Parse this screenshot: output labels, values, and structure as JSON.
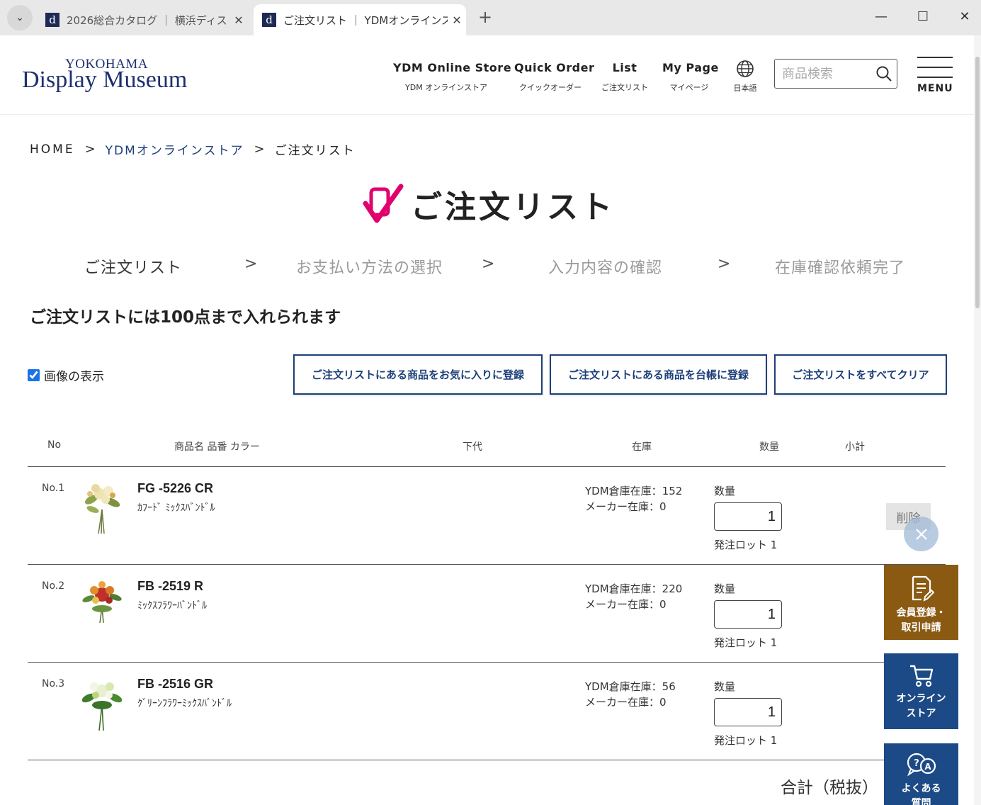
{
  "browser": {
    "tabs": [
      {
        "title": "2026総合カタログ ｜ 横浜ディス",
        "favicon_letter": "d",
        "active": false
      },
      {
        "title": "ご注文リスト ｜ YDMオンラインスト",
        "favicon_letter": "d",
        "active": true
      }
    ],
    "new_tab": "+",
    "controls": {
      "minimize": "—",
      "maximize": "☐",
      "close": "✕"
    },
    "tab_close": "✕",
    "tab_menu": "⌄"
  },
  "header": {
    "logo_top": "YOKOHAMA",
    "logo_main": "Display Museum",
    "nav": [
      {
        "en": "YDM Online Store",
        "ja": "YDM オンラインストア"
      },
      {
        "en": "Quick Order",
        "ja": "クイックオーダー"
      },
      {
        "en": "List",
        "ja": "ご注文リスト"
      },
      {
        "en": "My Page",
        "ja": "マイページ"
      }
    ],
    "language": "日本語",
    "search_placeholder": "商品検索",
    "menu_label": "MENU"
  },
  "breadcrumb": {
    "home": "HOME",
    "store": "YDMオンラインストア",
    "current": "ご注文リスト",
    "separator": ">"
  },
  "page_title": "ご注文リスト",
  "steps": [
    {
      "label": "ご注文リスト",
      "active": true
    },
    {
      "label": "お支払い方法の選択",
      "active": false
    },
    {
      "label": "入力内容の確認",
      "active": false
    },
    {
      "label": "在庫確認依頼完了",
      "active": false
    }
  ],
  "step_arrow": ">",
  "limit_text": "ご注文リストには100点まで入れられます",
  "show_images": {
    "label": "画像の表示",
    "checked": true
  },
  "actions": {
    "add_favorites": "ご注文リストにある商品をお気に入りに登録",
    "add_ledger": "ご注文リストにある商品を台帳に登録",
    "clear_all": "ご注文リストをすべてクリア"
  },
  "table": {
    "headers": {
      "no": "No",
      "name": "商品名 品番 カラー",
      "price": "下代",
      "stock": "在庫",
      "qty": "数量",
      "subtotal": "小計"
    },
    "rows": [
      {
        "no": "No.1",
        "code": "FG -5226 CR",
        "name": "ｶﾌｰﾄﾞ ﾐｯｸｽﾊﾞﾝﾄﾞﾙ",
        "stock_ydm": "YDM倉庫在庫：152",
        "stock_maker": "メーカー在庫：0",
        "qty_label": "数量",
        "qty": "1",
        "lot": "発注ロット 1"
      },
      {
        "no": "No.2",
        "code": "FB -2519 R",
        "name": "ﾐｯｸｽﾌﾗﾜｰﾊﾞﾝﾄﾞﾙ",
        "stock_ydm": "YDM倉庫在庫：220",
        "stock_maker": "メーカー在庫：0",
        "qty_label": "数量",
        "qty": "1",
        "lot": "発注ロット 1"
      },
      {
        "no": "No.3",
        "code": "FB -2516 GR",
        "name": "ｸﾞﾘｰﾝﾌﾗﾜｰﾐｯｸｽﾊﾞﾝﾄﾞﾙ",
        "stock_ydm": "YDM倉庫在庫：56",
        "stock_maker": "メーカー在庫：0",
        "qty_label": "数量",
        "qty": "1",
        "lot": "発注ロット 1"
      }
    ],
    "delete_label": "削除"
  },
  "total_label": "合計（税抜）",
  "side": {
    "member_line1": "会員登録・",
    "member_line2": "取引申請",
    "store_line1": "オンライン",
    "store_line2": "ストア",
    "faq_line1": "よくある",
    "faq_line2": "質問"
  },
  "colors": {
    "brand_navy": "#1d2f6f",
    "accent_pink": "#e0006e",
    "side_brown": "#8a5a12",
    "side_blue": "#1c4a86"
  }
}
